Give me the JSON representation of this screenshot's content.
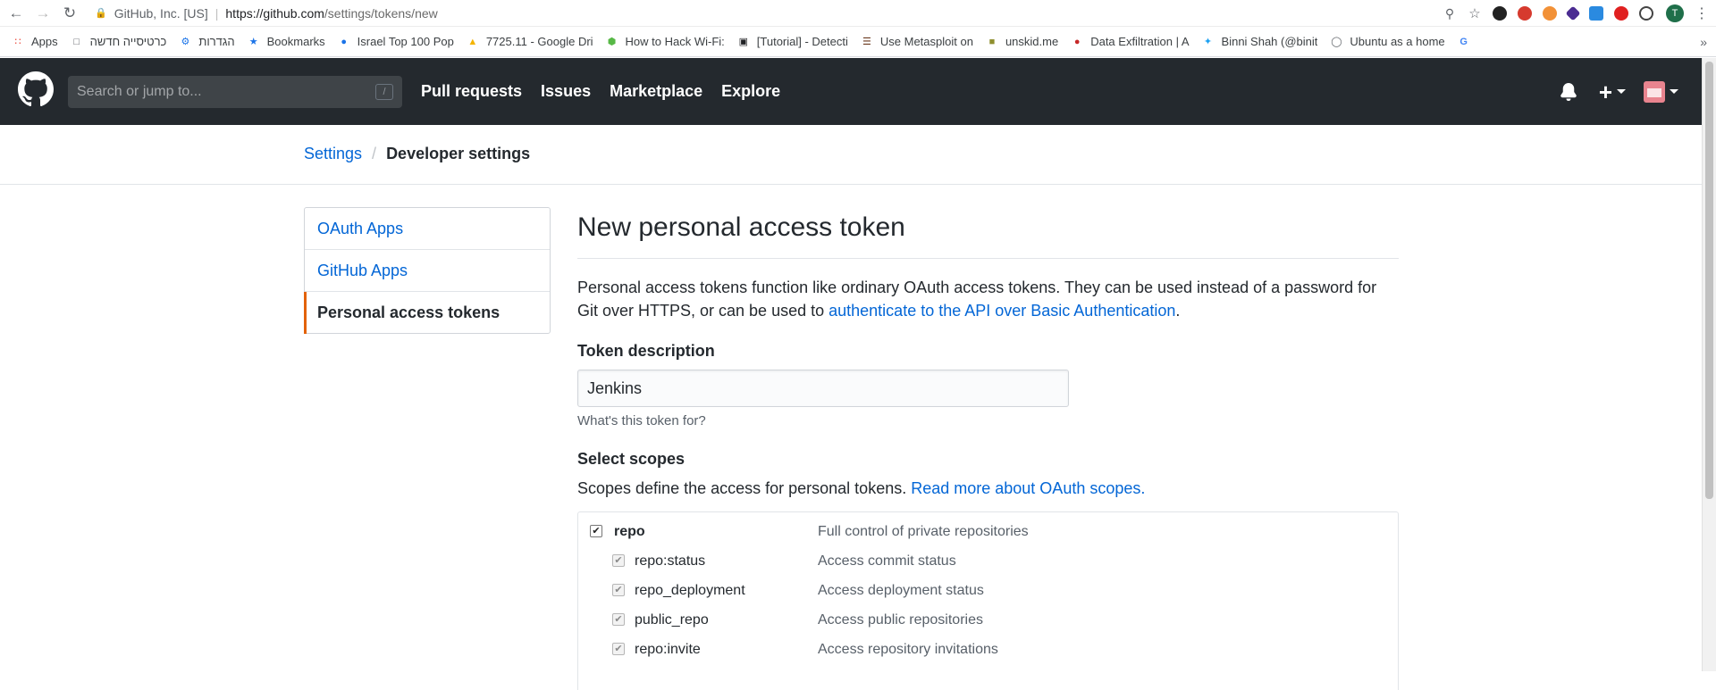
{
  "browser": {
    "org": "GitHub, Inc. [US]",
    "url_host": "https://github.com",
    "url_path": "/settings/tokens/new",
    "profile_initial": "T",
    "bookmarks": [
      {
        "label": "Apps",
        "icon": "apps-grid-icon"
      },
      {
        "label": "כרטיסייה חדשה",
        "icon": "page-icon"
      },
      {
        "label": "הגדרות",
        "icon": "gear-icon"
      },
      {
        "label": "Bookmarks",
        "icon": "star-icon"
      },
      {
        "label": "Israel Top 100 Pop",
        "icon": "blue-logo-icon"
      },
      {
        "label": "7725.11 - Google Dri",
        "icon": "drive-icon"
      },
      {
        "label": "How to Hack Wi-Fi:",
        "icon": "green-logo-icon"
      },
      {
        "label": "[Tutorial] - Detecti",
        "icon": "laptop-icon"
      },
      {
        "label": "Use Metasploit on",
        "icon": "stripes-icon"
      },
      {
        "label": "unskid.me",
        "icon": "face-icon"
      },
      {
        "label": "Data Exfiltration | A",
        "icon": "red-logo-icon"
      },
      {
        "label": "Binni Shah (@binit",
        "icon": "twitter-icon"
      },
      {
        "label": "Ubuntu as a home",
        "icon": "circle-icon"
      },
      {
        "label": "",
        "icon": "google-icon"
      }
    ]
  },
  "header": {
    "search_placeholder": "Search or jump to...",
    "search_shortcut": "/",
    "nav": [
      "Pull requests",
      "Issues",
      "Marketplace",
      "Explore"
    ]
  },
  "breadcrumb": {
    "parent": "Settings",
    "separator": "/",
    "current": "Developer settings"
  },
  "sidebar": {
    "items": [
      {
        "label": "OAuth Apps",
        "selected": false
      },
      {
        "label": "GitHub Apps",
        "selected": false
      },
      {
        "label": "Personal access tokens",
        "selected": true
      }
    ]
  },
  "main": {
    "title": "New personal access token",
    "intro_text": "Personal access tokens function like ordinary OAuth access tokens. They can be used instead of a password for Git over HTTPS, or can be used to ",
    "intro_link": "authenticate to the API over Basic Authentication",
    "intro_end": ".",
    "token_label": "Token description",
    "token_value": "Jenkins",
    "token_note": "What's this token for?",
    "scopes_title": "Select scopes",
    "scopes_desc": "Scopes define the access for personal tokens. ",
    "scopes_link": "Read more about OAuth scopes.",
    "scopes": [
      {
        "name": "repo",
        "desc": "Full control of private repositories",
        "checked": true,
        "level": 0
      },
      {
        "name": "repo:status",
        "desc": "Access commit status",
        "checked": true,
        "level": 1
      },
      {
        "name": "repo_deployment",
        "desc": "Access deployment status",
        "checked": true,
        "level": 1
      },
      {
        "name": "public_repo",
        "desc": "Access public repositories",
        "checked": true,
        "level": 1
      },
      {
        "name": "repo:invite",
        "desc": "Access repository invitations",
        "checked": true,
        "level": 1
      }
    ]
  }
}
